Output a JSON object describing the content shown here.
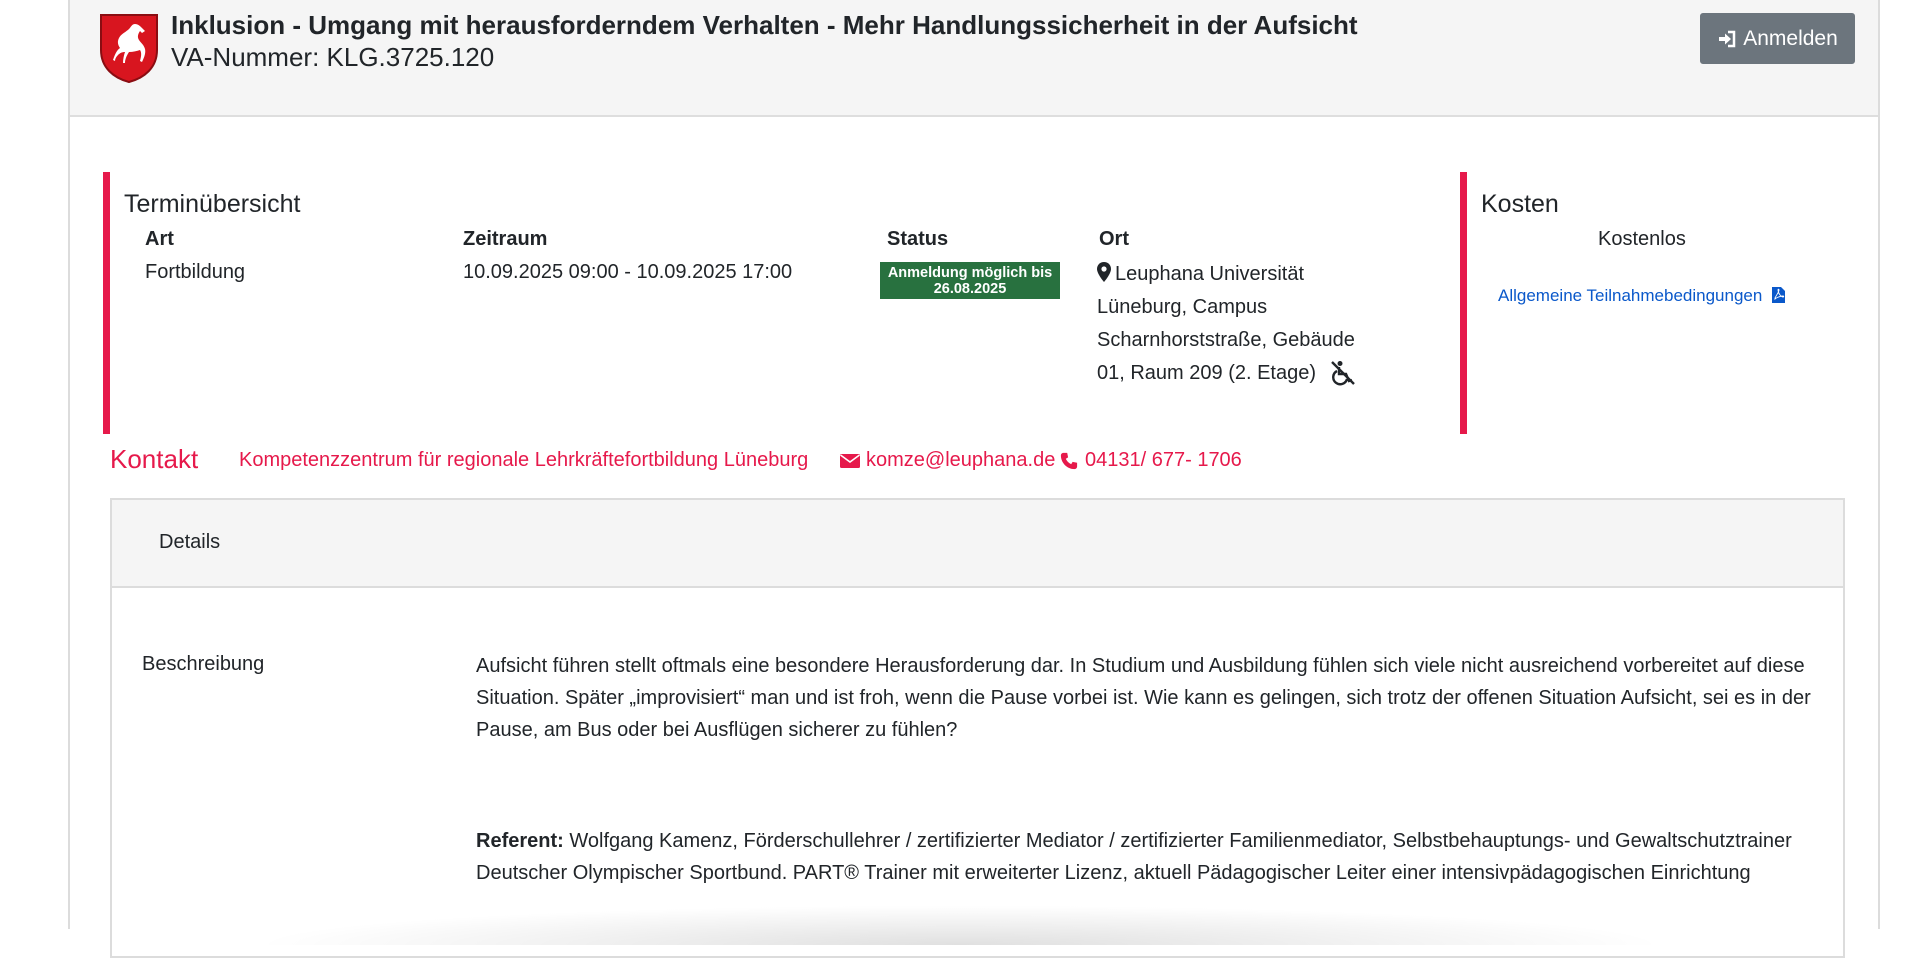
{
  "header": {
    "title": "Inklusion - Umgang mit herausforderndem Verhalten - Mehr Handlungssicherheit in der Aufsicht",
    "va_number": "VA-Nummer: KLG.3725.120",
    "login_label": "Anmelden"
  },
  "terminuebersicht": {
    "heading": "Terminübersicht",
    "columns": {
      "art": {
        "label": "Art",
        "value": "Fortbildung"
      },
      "zeitraum": {
        "label": "Zeitraum",
        "value": "10.09.2025 09:00 - 10.09.2025 17:00"
      },
      "status": {
        "label": "Status",
        "badge_line1": "Anmeldung möglich bis",
        "badge_line2": "26.08.2025"
      },
      "ort": {
        "label": "Ort",
        "value": "Leuphana Universität Lüneburg, Campus Scharnhorststraße, Gebäude 01, Raum 209 (2. Etage)"
      }
    }
  },
  "kosten": {
    "heading": "Kosten",
    "value": "Kostenlos",
    "terms_link": "Allgemeine Teilnahmebedingungen"
  },
  "kontakt": {
    "label": "Kontakt",
    "organization": "Kompetenzzentrum für regionale Lehrkräftefortbildung Lüneburg",
    "email": "komze@leuphana.de",
    "phone": "04131/ 677- 1706"
  },
  "details": {
    "title": "Details",
    "row_label": "Beschreibung",
    "description": "Aufsicht führen stellt oftmals eine besondere Herausforderung dar. In Studium und Ausbildung fühlen sich viele nicht ausreichend vorbereitet auf diese Situation. Später „improvisiert“ man und ist froh, wenn die Pause vorbei ist. Wie kann es gelingen, sich trotz der offenen Situation Aufsicht, sei es in der Pause, am Bus oder bei Ausflügen sicherer zu fühlen?",
    "referent_label": "Referent:",
    "referent_text": "Wolfgang Kamenz, Förderschullehrer / zertifizierter Mediator / zertifizierter Familienmediator, Selbstbehauptungs- und Gewaltschutztrainer Deutscher Olympischer Sportbund. PART® Trainer mit erweiterter Lizenz, aktuell Pädagogischer Leiter einer intensivpädagogischen Einrichtung"
  },
  "colors": {
    "accent": "#e6194b",
    "status_green": "#28713f",
    "button_gray": "#6c757d",
    "link_blue": "#0a58ca"
  },
  "icons": [
    "niedersachsen-crest-icon",
    "sign-in-icon",
    "map-marker-icon",
    "wheelchair-icon",
    "pdf-file-icon",
    "envelope-icon",
    "phone-icon"
  ]
}
